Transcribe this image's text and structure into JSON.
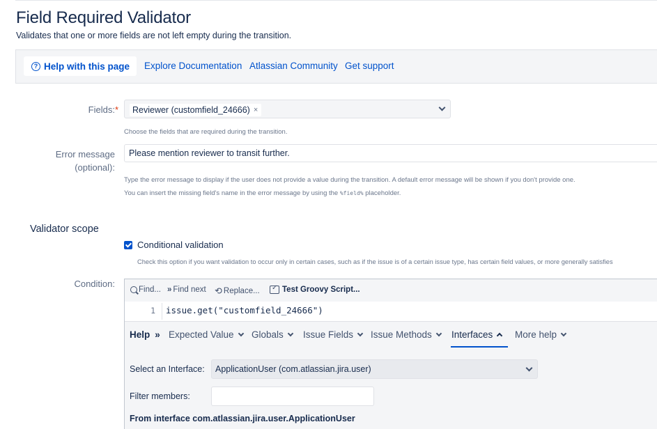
{
  "page": {
    "title": "Field Required Validator",
    "description": "Validates that one or more fields are not left empty during the transition."
  },
  "help_bar": {
    "help_button": "Help with this page",
    "links": [
      "Explore Documentation",
      "Atlassian Community",
      "Get support"
    ]
  },
  "fields": {
    "label": "Fields:",
    "required_mark": "*",
    "selected_chip": "Reviewer (customfield_24666)",
    "chip_remove": "×",
    "hint": "Choose the fields that are required during the transition."
  },
  "error_message": {
    "label_line1": "Error message",
    "label_line2": "(optional):",
    "value": "Please mention reviewer to transit further.",
    "hint_line1": "Type the error message to display if the user does not provide a value during the transition. A default error message will be shown if you don't provide one.",
    "hint_line2_pre": "You can insert the missing field's name in the error message by using the ",
    "hint_line2_code": "%field%",
    "hint_line2_post": " placeholder."
  },
  "validator_scope": {
    "title": "Validator scope",
    "checkbox_label": "Conditional validation",
    "checkbox_checked": true,
    "hint": "Check this option if you want validation to occur only in certain cases, such as if the issue is of a certain issue type, has certain field values, or more generally satisfies"
  },
  "condition": {
    "label": "Condition:",
    "toolbar": {
      "find": "Find...",
      "find_next": "Find next",
      "replace": "Replace...",
      "test_script": "Test Groovy Script..."
    },
    "code": {
      "line_number": "1",
      "line_text": "issue.get(\"customfield_24666\")"
    },
    "help_tabs": {
      "help": "Help",
      "help_arrow": "»",
      "tabs": [
        "Expected Value",
        "Globals",
        "Issue Fields",
        "Issue Methods",
        "Interfaces",
        "More help"
      ],
      "active_tab": "Interfaces"
    },
    "interface_panel": {
      "select_label": "Select an Interface:",
      "select_value": "ApplicationUser (com.atlassian.jira.user)",
      "filter_label": "Filter members:",
      "filter_value": "",
      "from_text": "From interface com.atlassian.jira.user.ApplicationUser"
    }
  },
  "colors": {
    "link": "#0052cc",
    "text": "#172b4d",
    "muted": "#5e6c84",
    "required": "#de350b",
    "panel_bg": "#f4f5f7"
  }
}
